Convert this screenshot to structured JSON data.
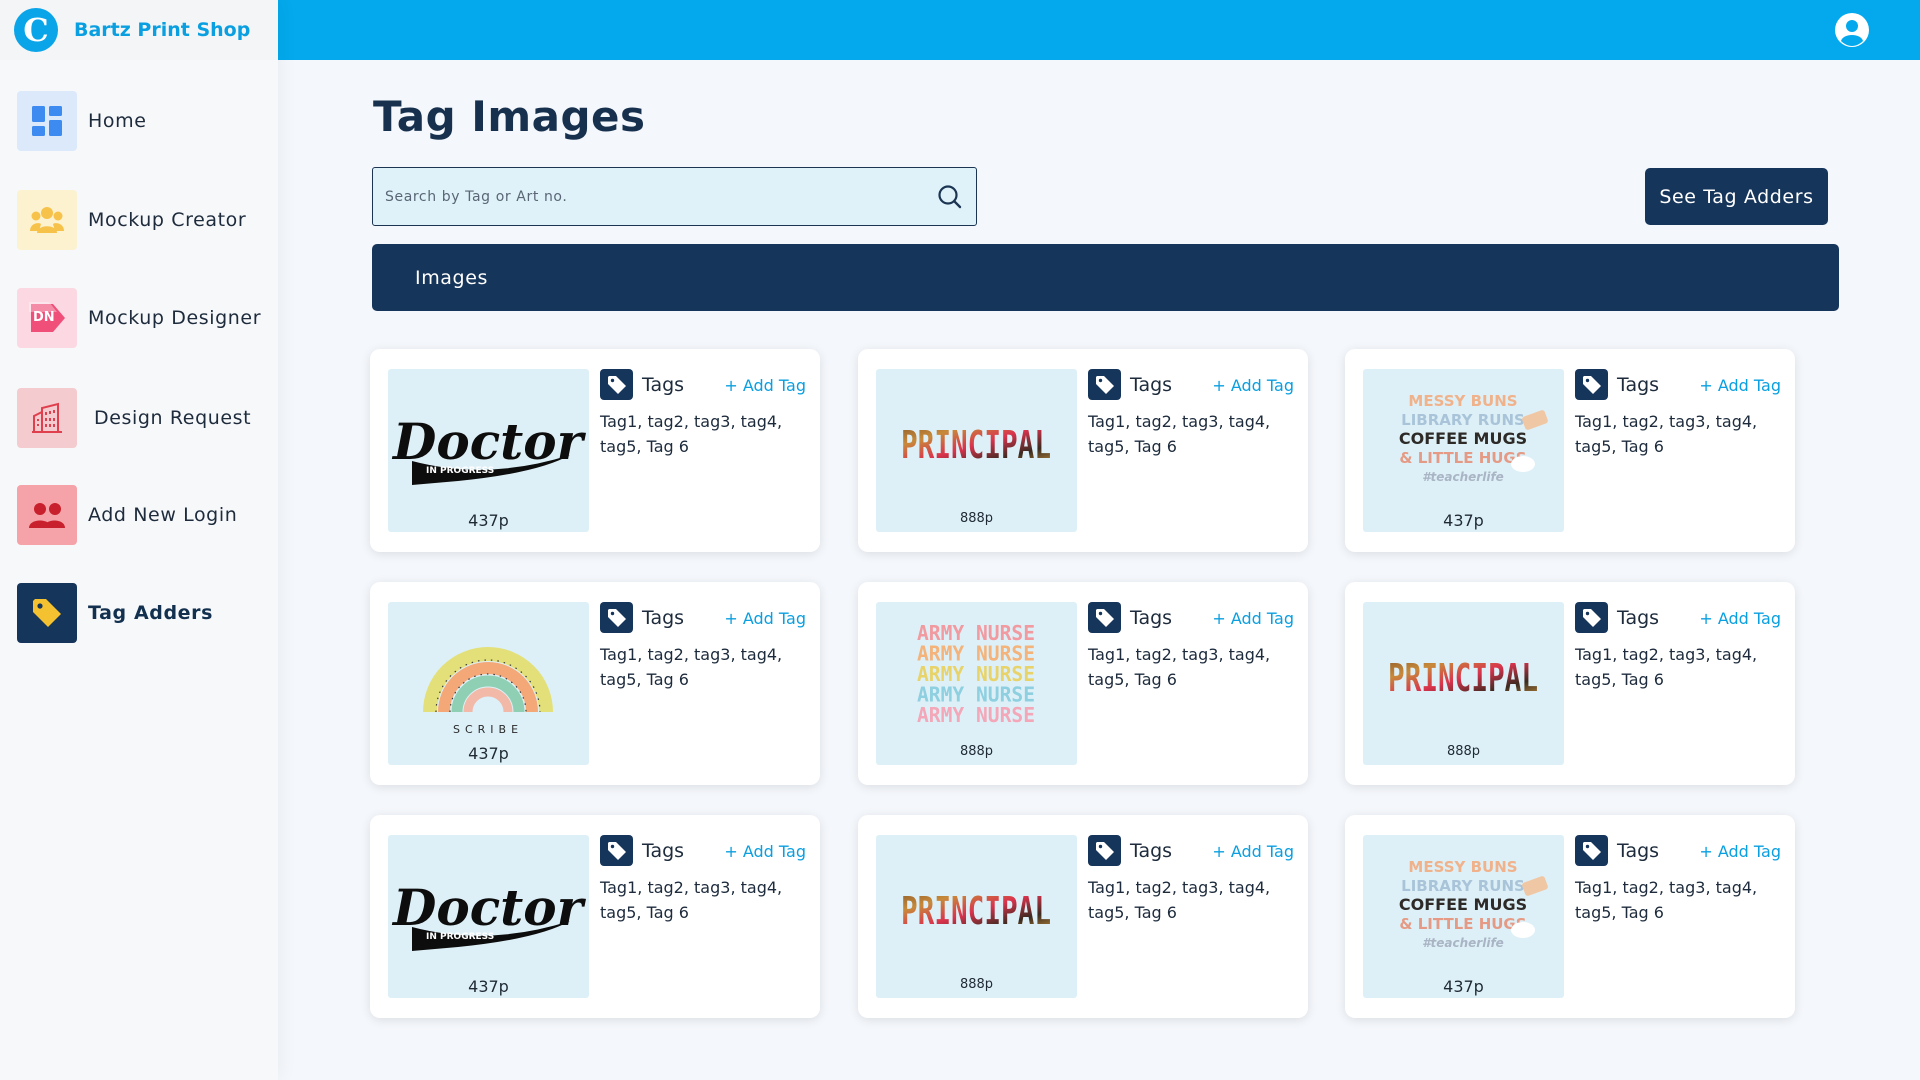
{
  "app": {
    "brand_initial": "C",
    "brand_name": "Bartz Print Shop"
  },
  "sidebar": {
    "items": [
      {
        "label": "Home",
        "icon": "dashboard-icon",
        "active": false
      },
      {
        "label": "Mockup Creator",
        "icon": "users-group-icon",
        "active": false
      },
      {
        "label": "Mockup Designer",
        "icon": "designer-icon",
        "active": false
      },
      {
        "label": "Design Request",
        "icon": "building-icon",
        "active": false
      },
      {
        "label": "Add New Login",
        "icon": "add-users-icon",
        "active": false
      },
      {
        "label": "Tag Adders",
        "icon": "tag-icon",
        "active": true
      }
    ]
  },
  "colors": {
    "primary": "#16355a",
    "accent": "#03a9ec",
    "link": "#0a9fe0",
    "thumb_bg": "#def0f7"
  },
  "header": {
    "user_icon": "user-circle-icon"
  },
  "main": {
    "title": "Tag Images",
    "search": {
      "placeholder": "Search by Tag or Art no.",
      "value": ""
    },
    "see_tag_adders": "See Tag Adders",
    "section_label": "Images",
    "tags_label": "Tags",
    "add_tag_label": "+ Add Tag",
    "cards": [
      {
        "art_no": "437p",
        "tags": "Tag1, tag2, tag3, tag4, tag5, Tag 6",
        "design": "doctor-in-progress",
        "art": {
          "main": "Doctor",
          "sub": "IN PROGRESS"
        }
      },
      {
        "art_no": "888p",
        "tags": "Tag1, tag2, tag3, tag4, tag5, Tag 6",
        "design": "principal",
        "art": {
          "main": "PRINCIPAL"
        }
      },
      {
        "art_no": "437p",
        "tags": "Tag1, tag2, tag3, tag4, tag5, Tag 6",
        "design": "messy-buns",
        "art": {
          "lines": [
            "MESSY BUNS",
            "LIBRARY RUNS",
            "COFFEE MUGS",
            "& LITTLE HUGS",
            "#teacherlife"
          ]
        }
      },
      {
        "art_no": "437p",
        "tags": "Tag1, tag2, tag3, tag4, tag5, Tag 6",
        "design": "rainbow-scribe",
        "art": {
          "main": "SCRIBE"
        }
      },
      {
        "art_no": "888p",
        "tags": "Tag1, tag2, tag3, tag4, tag5, Tag 6",
        "design": "army-nurse",
        "art": {
          "lines": [
            "ARMY NURSE",
            "ARMY NURSE",
            "ARMY NURSE",
            "ARMY NURSE",
            "ARMY NURSE"
          ]
        }
      },
      {
        "art_no": "888p",
        "tags": "Tag1, tag2, tag3, tag4, tag5, Tag 6",
        "design": "principal",
        "art": {
          "main": "PRINCIPAL"
        }
      },
      {
        "art_no": "437p",
        "tags": "Tag1, tag2, tag3, tag4, tag5, Tag 6",
        "design": "doctor-in-progress",
        "art": {
          "main": "Doctor",
          "sub": "IN PROGRESS"
        }
      },
      {
        "art_no": "888p",
        "tags": "Tag1, tag2, tag3, tag4, tag5, Tag 6",
        "design": "principal",
        "art": {
          "main": "PRINCIPAL"
        }
      },
      {
        "art_no": "437p",
        "tags": "Tag1, tag2, tag3, tag4, tag5, Tag 6",
        "design": "messy-buns",
        "art": {
          "lines": [
            "MESSY BUNS",
            "LIBRARY RUNS",
            "COFFEE MUGS",
            "& LITTLE HUGS",
            "#teacherlife"
          ]
        }
      }
    ]
  }
}
